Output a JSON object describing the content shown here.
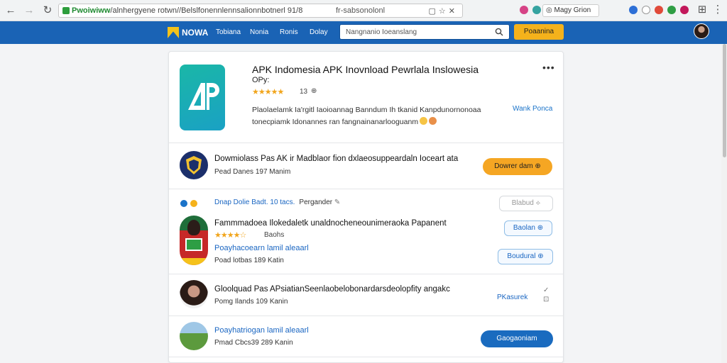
{
  "browser": {
    "url_domain": "Pwoiwiww",
    "url_path": "/alnhergyene rotwn//Belslfonennlennsalionnbotnerl 91/8",
    "url_mid": "fr-sabsonolonl",
    "profile_chip": "Magy Grion"
  },
  "header": {
    "logo": "NOWA",
    "nav": [
      "Tobiana",
      "Nonia",
      "Ronis",
      "Dolay"
    ],
    "search_placeholder": "Nangnanio Ioeanslang",
    "button": "Poaanina"
  },
  "app": {
    "title": "APK Indomesia APK Inovnload Pewrlala Inslowesia",
    "subtitle": "OPy:",
    "rating_count": "13",
    "description": "Plaolaelamk Ia'rgitl Iaoioannag Banndum Ih tkanid Kanpdunornonoaa tonecpiamk Idonannes ran fangnainanarlooguanm",
    "side_link": "Wank Ponca",
    "more": "•••"
  },
  "rows": {
    "row1": {
      "title": "Dowmiolass Pas AK ir Madblaor fion dxlaeosuppeardaln Ioceart ata",
      "meta": "Pead Danes 197 Manim",
      "button": "Dowrer dam ⊕"
    },
    "source": {
      "text": "Dnap Dolie Badt. 10 tacs.",
      "author": "Pergander",
      "button": "Blabud ⟡"
    },
    "row2": {
      "title": "Fammmadoea Ilokedaletk unaldnocheneounimeraoka Papanent",
      "rating": "Baohs",
      "link": "Poayhacoearn lamil aleaarl",
      "meta": "Poad lotbas 189 Katin",
      "button_a": "Baolan ⊕",
      "button_b": "Boudural ⊕"
    },
    "row3": {
      "title": "Gloolquad Pas APsiatianSeenlaobelobonardarsdeolopfity angakc",
      "meta": "Pomg Ilands 109 Kanin",
      "side": "PKasurek"
    },
    "row4": {
      "link": "Poayhatriogan lamil aleaarl",
      "meta": "Pmad Cbcs39 289 Kanin",
      "button": "Gaogaoniam"
    }
  },
  "colors": {
    "header": "#1a63b5",
    "accent_orange": "#f5a623",
    "accent_blue": "#1a6bbf",
    "star": "#f1a51c"
  }
}
